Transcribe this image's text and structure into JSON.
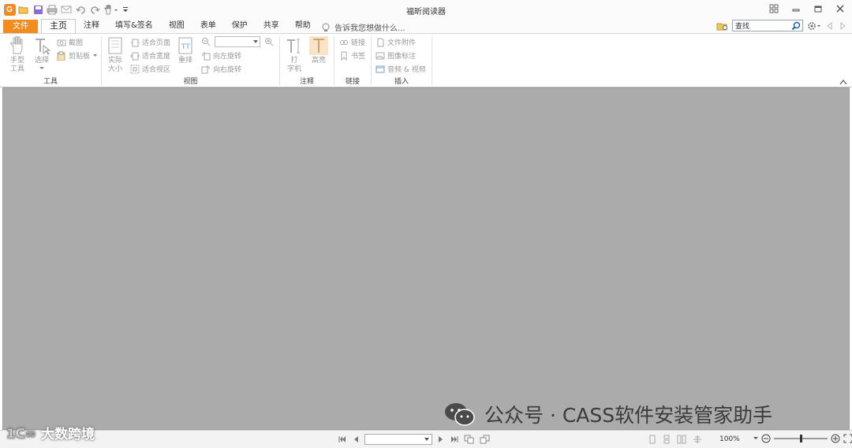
{
  "window": {
    "title": "福昕阅读器"
  },
  "quick_access": {
    "icons": [
      "app-logo",
      "open-folder-icon",
      "save-icon",
      "print-icon",
      "email-icon",
      "undo-icon",
      "redo-icon",
      "hand-tool-icon",
      "customize-icon"
    ]
  },
  "ribbon_tabs": {
    "file": "文件",
    "items": [
      "主页",
      "注释",
      "填写&签名",
      "视图",
      "表单",
      "保护",
      "共享",
      "帮助"
    ],
    "active": "主页",
    "tell_me": "告诉我您想做什么...",
    "search_value": "查找"
  },
  "ribbon": {
    "tools": {
      "label": "工具",
      "hand_line1": "手型",
      "hand_line2": "工具",
      "select": "选择",
      "screenshot": "截图",
      "clipboard": "剪贴板"
    },
    "view": {
      "label": "视图",
      "actual_line1": "实际",
      "actual_line2": "大小",
      "fit_page": "适合页面",
      "fit_width": "适合宽度",
      "fit_visible": "适合视区",
      "reflow": "重排",
      "rotate_left": "向左旋转",
      "rotate_right": "向右旋转",
      "zoom_value": ""
    },
    "comment": {
      "label": "注释",
      "typewriter_line1": "打",
      "typewriter_line2": "字机",
      "highlight": "高亮"
    },
    "links": {
      "label": "链接",
      "link": "链接",
      "bookmark": "书签"
    },
    "insert": {
      "label": "插入",
      "file_attachment": "文件附件",
      "image_annotation": "图像标注",
      "audio_video": "音频 & 视频"
    }
  },
  "statusbar": {
    "page_value": "",
    "zoom": "100%",
    "zoom_level": 0.5
  },
  "watermarks": {
    "left": "大数跨境",
    "right": "公众号 · CASS软件安装管家助手"
  },
  "colors": {
    "accent": "#f28c1e",
    "document_bg": "#aaabaa"
  }
}
